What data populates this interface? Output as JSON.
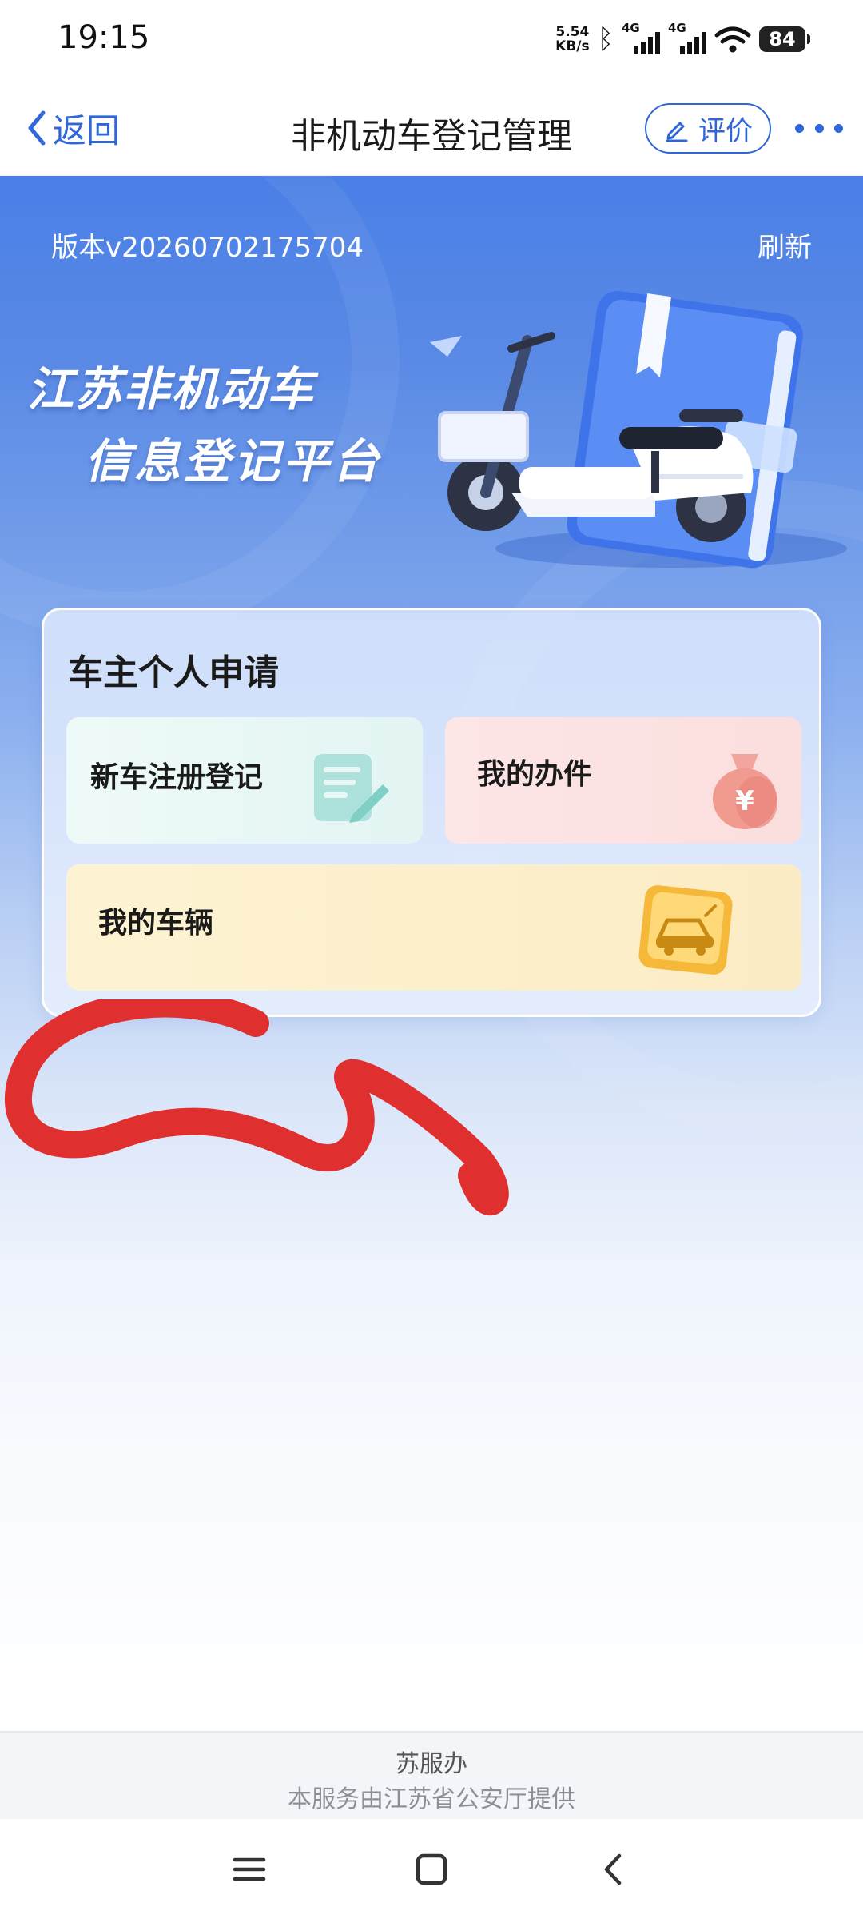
{
  "status_bar": {
    "time": "19:15",
    "net_speed_value": "5.54",
    "net_speed_unit": "KB/s",
    "signal1_tag": "4G",
    "signal2_tag": "4G",
    "battery": "84"
  },
  "nav": {
    "back_label": "返回",
    "title": "非机动车登记管理",
    "rate_label": "评价"
  },
  "hero": {
    "version": "版本v20260702175704",
    "refresh": "刷新",
    "brand_line1": "江苏非机动车",
    "brand_line2": "信息登记平台"
  },
  "apply_card": {
    "title": "车主个人申请",
    "tiles": [
      {
        "label": "新车注册登记",
        "icon": "document-pen-icon"
      },
      {
        "label": "我的办件",
        "icon": "money-bag-icon"
      },
      {
        "label": "我的车辆",
        "icon": "car-sign-icon"
      }
    ]
  },
  "footer": {
    "provider": "苏服办",
    "note": "本服务由江苏省公安厅提供"
  },
  "colors": {
    "accent": "#2f67d8",
    "hero_top": "#4a7fe6",
    "annotation": "#e02f2f"
  }
}
